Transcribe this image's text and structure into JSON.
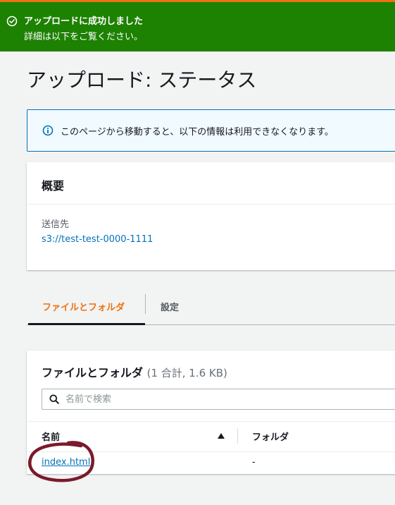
{
  "colors": {
    "success": "#1d8102",
    "accent": "#ec7211",
    "link": "#0073bb",
    "info_border": "#0073bb",
    "annotation": "#7a1a2b"
  },
  "flash": {
    "icon": "check-circle-icon",
    "title": "アップロードに成功しました",
    "body": "詳細は以下をご覧ください。"
  },
  "page": {
    "title": "アップロード: ステータス"
  },
  "info_alert": {
    "icon": "info-icon",
    "text": "このページから移動すると、以下の情報は利用できなくなります。"
  },
  "summary": {
    "title": "概要",
    "destination_label": "送信先",
    "destination_value": "s3://test-test-0000-1111"
  },
  "tabs": [
    {
      "label": "ファイルとフォルダ",
      "active": true
    },
    {
      "label": "設定",
      "active": false
    }
  ],
  "files": {
    "title": "ファイルとフォルダ",
    "count": "(1 合計, 1.6 KB)",
    "search_placeholder": "名前で検索",
    "search_value": "",
    "columns": [
      "名前",
      "フォルダ"
    ],
    "sort_icon": "sort-ascending-icon",
    "rows": [
      {
        "name": "index.html",
        "folder": "-"
      }
    ]
  }
}
